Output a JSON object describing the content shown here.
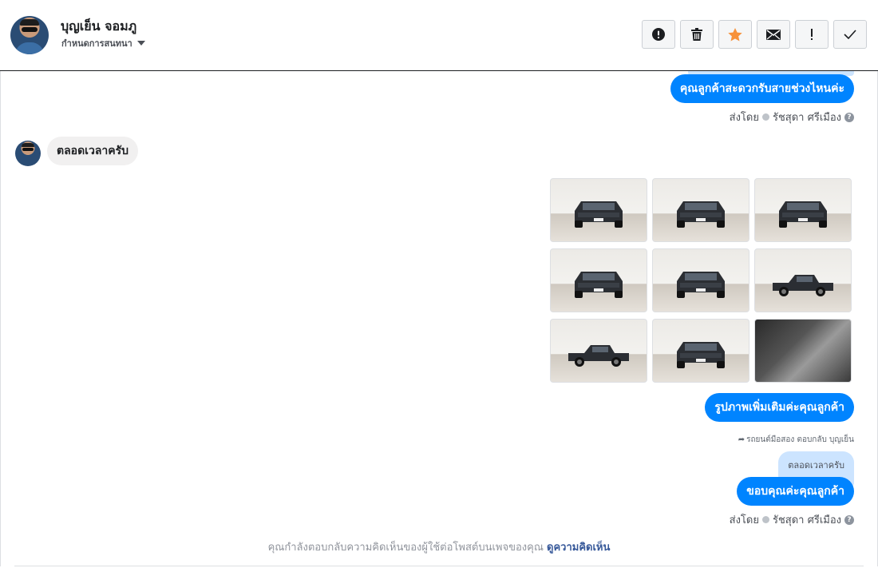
{
  "header": {
    "user_name": "บุญเย็น จอมภู",
    "settings_label": "กำหนดการสนทนา",
    "toolbar": [
      {
        "name": "mark-spam-button",
        "icon": "alert-circle-icon"
      },
      {
        "name": "delete-button",
        "icon": "trash-icon"
      },
      {
        "name": "star-button",
        "icon": "star-icon"
      },
      {
        "name": "mark-unread-button",
        "icon": "envelope-icon"
      },
      {
        "name": "follow-up-button",
        "icon": "exclamation-icon"
      },
      {
        "name": "mark-done-button",
        "icon": "checkmark-icon"
      }
    ],
    "star_color": "#f7923b"
  },
  "messages": {
    "out_1": "คุณลูกค้าสะดวกรับสายช่วงไหนค่ะ",
    "sent_by_prefix": "ส่งโดย",
    "sent_by_name": "รัชสุดา ศรีเมือง",
    "in_1": "ตลอดเวลาครับ",
    "photos": [
      "truck-front-left",
      "truck-front",
      "truck-rear-right",
      "truck-rear-left",
      "truck-front-right",
      "truck-side-right",
      "truck-side-left",
      "truck-rear",
      "truck-interior"
    ],
    "out_2": "รูปภาพเพิ่มเติมค่ะคุณลูกค้า",
    "reply_note": "รถยนต์มือสอง ตอบกลับ บุญเย็น",
    "quoted_text": "ตลอดเวลาครับ",
    "out_3": "ขอบคุณค่ะคุณลูกค้า",
    "sent_by_prefix_2": "ส่งโดย",
    "sent_by_name_2": "รัชสุดา ศรีเมือง"
  },
  "footer": {
    "note": "คุณกำลังตอบกลับความคิดเห็นของผู้ใช้ต่อโพสต์บนเพจของคุณ",
    "link": "ดูความคิดเห็น"
  },
  "colors": {
    "accent": "#0084ff",
    "incoming_bubble": "#f1f0f0",
    "quoted_bubble": "#cce4ff",
    "link": "#365899"
  }
}
